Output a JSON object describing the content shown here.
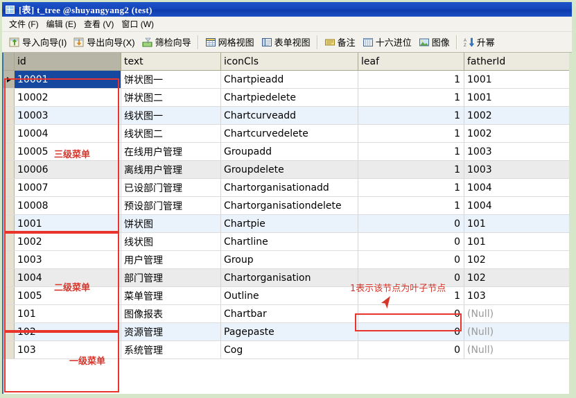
{
  "window": {
    "title": "[表] t_tree @shuyangyang2  (test)",
    "title_icon": "table-grid-icon"
  },
  "menubar": {
    "items": [
      {
        "label": "文件 (F)",
        "name": "menu-file"
      },
      {
        "label": "编辑 (E)",
        "name": "menu-edit"
      },
      {
        "label": "查看 (V)",
        "name": "menu-view"
      },
      {
        "label": "窗口 (W)",
        "name": "menu-window"
      }
    ]
  },
  "toolbar": {
    "buttons": [
      {
        "label": "导入向导(I)",
        "icon": "import-wizard-icon"
      },
      {
        "label": "导出向导(X)",
        "icon": "export-wizard-icon"
      },
      {
        "label": "筛检向导",
        "icon": "filter-wizard-icon"
      },
      {
        "label": "网格视图",
        "icon": "grid-view-icon"
      },
      {
        "label": "表单视图",
        "icon": "form-view-icon"
      },
      {
        "label": "备注",
        "icon": "memo-icon"
      },
      {
        "label": "十六进位",
        "icon": "hex-icon"
      },
      {
        "label": "图像",
        "icon": "image-icon"
      },
      {
        "label": "升幂",
        "icon": "sort-ascending-icon"
      }
    ]
  },
  "grid": {
    "columns": [
      {
        "key": "id",
        "label": "id"
      },
      {
        "key": "text",
        "label": "text"
      },
      {
        "key": "iconCls",
        "label": "iconCls"
      },
      {
        "key": "leaf",
        "label": "leaf"
      },
      {
        "key": "fatherId",
        "label": "fatherId"
      }
    ],
    "selected_column": "id",
    "selected_row_index": 0,
    "rows": [
      {
        "id": "10001",
        "text": "饼状图一",
        "iconCls": "Chartpieadd",
        "leaf": "1",
        "fatherId": "1001",
        "bg": "selected",
        "marker": true
      },
      {
        "id": "10002",
        "text": "饼状图二",
        "iconCls": "Chartpiedelete",
        "leaf": "1",
        "fatherId": "1001",
        "bg": "bg-white",
        "marker": false
      },
      {
        "id": "10003",
        "text": "线状图一",
        "iconCls": "Chartcurveadd",
        "leaf": "1",
        "fatherId": "1002",
        "bg": "bg-blue",
        "marker": false
      },
      {
        "id": "10004",
        "text": "线状图二",
        "iconCls": "Chartcurvedelete",
        "leaf": "1",
        "fatherId": "1002",
        "bg": "bg-white",
        "marker": false
      },
      {
        "id": "10005",
        "text": "在线用户管理",
        "iconCls": "Groupadd",
        "leaf": "1",
        "fatherId": "1003",
        "bg": "bg-white",
        "marker": false
      },
      {
        "id": "10006",
        "text": "离线用户管理",
        "iconCls": "Groupdelete",
        "leaf": "1",
        "fatherId": "1003",
        "bg": "bg-gray",
        "marker": false
      },
      {
        "id": "10007",
        "text": "已设部门管理",
        "iconCls": "Chartorganisationadd",
        "leaf": "1",
        "fatherId": "1004",
        "bg": "bg-white",
        "marker": false
      },
      {
        "id": "10008",
        "text": "预设部门管理",
        "iconCls": "Chartorganisationdelete",
        "leaf": "1",
        "fatherId": "1004",
        "bg": "bg-white",
        "marker": false
      },
      {
        "id": "1001",
        "text": "饼状图",
        "iconCls": "Chartpie",
        "leaf": "0",
        "fatherId": "101",
        "bg": "bg-blue",
        "marker": false
      },
      {
        "id": "1002",
        "text": "线状图",
        "iconCls": "Chartline",
        "leaf": "0",
        "fatherId": "101",
        "bg": "bg-white",
        "marker": false
      },
      {
        "id": "1003",
        "text": "用户管理",
        "iconCls": "Group",
        "leaf": "0",
        "fatherId": "102",
        "bg": "bg-white",
        "marker": false
      },
      {
        "id": "1004",
        "text": "部门管理",
        "iconCls": "Chartorganisation",
        "leaf": "0",
        "fatherId": "102",
        "bg": "bg-gray",
        "marker": false
      },
      {
        "id": "1005",
        "text": "菜单管理",
        "iconCls": "Outline",
        "leaf": "1",
        "fatherId": "103",
        "bg": "bg-white",
        "marker": false
      },
      {
        "id": "101",
        "text": "图像报表",
        "iconCls": "Chartbar",
        "leaf": "0",
        "fatherId": "(Null)",
        "bg": "bg-white",
        "marker": false,
        "father_null": true
      },
      {
        "id": "102",
        "text": "资源管理",
        "iconCls": "Pagepaste",
        "leaf": "0",
        "fatherId": "(Null)",
        "bg": "bg-blue",
        "marker": false,
        "father_null": true
      },
      {
        "id": "103",
        "text": "系统管理",
        "iconCls": "Cog",
        "leaf": "0",
        "fatherId": "(Null)",
        "bg": "bg-white",
        "marker": false,
        "father_null": true
      }
    ]
  },
  "annotations": {
    "level3": "三级菜单",
    "level2": "二级菜单",
    "level1": "一级菜单",
    "leaf_note": "1表示该节点为叶子节点",
    "color": "#d6352a"
  }
}
